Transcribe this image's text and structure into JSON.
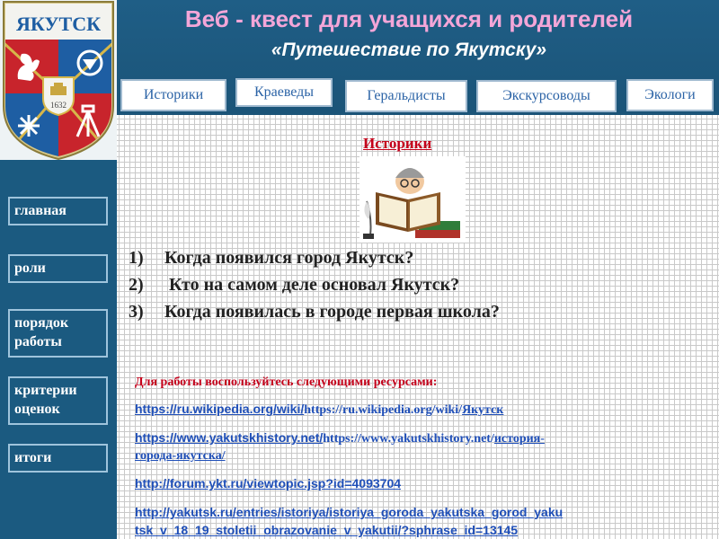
{
  "page": {
    "title": "Веб - квест для учащихся  и родителей",
    "subtitle": "«Путешествие по Якутску»"
  },
  "logo": {
    "city_name": "ЯКУТСК",
    "year": "1632"
  },
  "roles": [
    {
      "label": "Историки"
    },
    {
      "label": "Краеведы"
    },
    {
      "label": "Геральдисты"
    },
    {
      "label": "Экскурсоводы"
    },
    {
      "label": "Экологи"
    }
  ],
  "sidebar": {
    "items": [
      {
        "label": "главная"
      },
      {
        "label": "роли"
      },
      {
        "label": "порядок работы"
      },
      {
        "label": "критерии оценок"
      },
      {
        "label": "итоги"
      }
    ]
  },
  "content": {
    "section_title": "Историки",
    "illustration_icon": "historian-reading-book-icon",
    "questions": [
      {
        "num": "1)",
        "text": "Когда появился город Якутск?"
      },
      {
        "num": "2)",
        "text": " Кто на самом деле основал Якутск?"
      },
      {
        "num": "3)",
        "text": "Когда появилась в городе первая школа?"
      }
    ],
    "resources_intro": "Для работы воспользуйтесь следующими ресурсами:",
    "resources": [
      {
        "sans": "https://ru.wikipedia.org/wiki/",
        "serif": "https://ru.wikipedia.org/wiki/",
        "tail": "Якутск"
      },
      {
        "sans": "https://www.yakutskhistory.net/",
        "serif": "https://www.yakutskhistory.net/",
        "tail": "история-",
        "cont": "города-якутска/"
      },
      {
        "sans": "http://forum.ykt.ru/viewtopic.jsp?id=4093704"
      },
      {
        "sans": "http://yakutsk.ru/entries/istoriya/istoriya_goroda_yakutska_gorod_yaku",
        "cont": "tsk_v_18_19_stoletii_obrazovanie_v_yakutii/?sphrase_id=13145"
      }
    ]
  },
  "colors": {
    "header_bg": "#1f5e86",
    "title_pink": "#f4a6d8",
    "accent_red": "#c4001a",
    "link_blue": "#1f4fb8",
    "tab_text": "#2b63a6"
  }
}
